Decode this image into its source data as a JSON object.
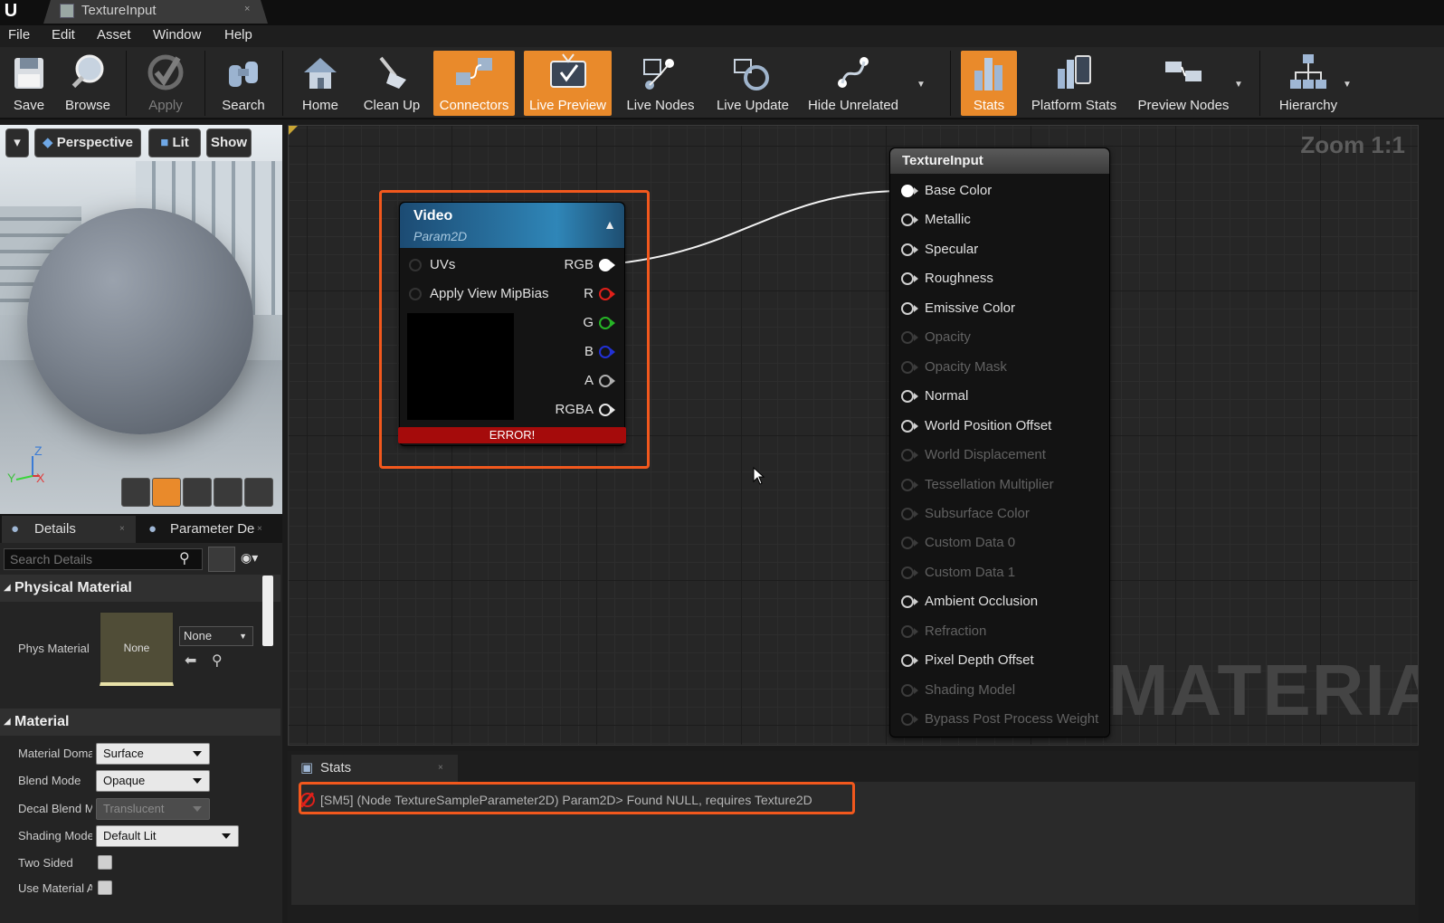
{
  "window": {
    "tab_title": "TextureInput",
    "tab_close": "×"
  },
  "menu": [
    "File",
    "Edit",
    "Asset",
    "Window",
    "Help"
  ],
  "toolbar": {
    "save": "Save",
    "browse": "Browse",
    "apply": "Apply",
    "search": "Search",
    "home": "Home",
    "clean_up": "Clean Up",
    "connectors": "Connectors",
    "live_preview": "Live Preview",
    "live_nodes": "Live Nodes",
    "live_update": "Live Update",
    "hide_unrelated": "Hide Unrelated",
    "stats": "Stats",
    "platform_stats": "Platform Stats",
    "preview_nodes": "Preview Nodes",
    "hierarchy": "Hierarchy"
  },
  "viewport": {
    "perspective": "Perspective",
    "lit": "Lit",
    "show": "Show",
    "axis_z": "Z",
    "axis_x": "X",
    "axis_y": "Y"
  },
  "details": {
    "tab_details": "Details",
    "tab_parameter": "Parameter De",
    "search_placeholder": "Search Details",
    "section_physical": "Physical Material",
    "phys_material_label": "Phys Material",
    "phys_thumb": "None",
    "phys_combo": "None",
    "section_material": "Material",
    "props": [
      {
        "label": "Material Doma",
        "value": "Surface"
      },
      {
        "label": "Blend Mode",
        "value": "Opaque"
      },
      {
        "label": "Decal Blend M",
        "value": "Translucent"
      },
      {
        "label": "Shading Mode",
        "value": "Default Lit"
      },
      {
        "label": "Two Sided",
        "value": ""
      },
      {
        "label": "Use Material A",
        "value": ""
      }
    ]
  },
  "graph": {
    "zoom": "Zoom 1:1",
    "watermark": "MATERIAL"
  },
  "video_node": {
    "title": "Video",
    "subtitle": "Param2D",
    "inputs": [
      "UVs",
      "Apply View MipBias"
    ],
    "outputs": [
      "RGB",
      "R",
      "G",
      "B",
      "A",
      "RGBA"
    ],
    "error": "ERROR!"
  },
  "texture_node": {
    "title": "TextureInput",
    "pins": [
      {
        "label": "Base Color",
        "enabled": true
      },
      {
        "label": "Metallic",
        "enabled": true
      },
      {
        "label": "Specular",
        "enabled": true
      },
      {
        "label": "Roughness",
        "enabled": true
      },
      {
        "label": "Emissive Color",
        "enabled": true
      },
      {
        "label": "Opacity",
        "enabled": false
      },
      {
        "label": "Opacity Mask",
        "enabled": false
      },
      {
        "label": "Normal",
        "enabled": true
      },
      {
        "label": "World Position Offset",
        "enabled": true
      },
      {
        "label": "World Displacement",
        "enabled": false
      },
      {
        "label": "Tessellation Multiplier",
        "enabled": false
      },
      {
        "label": "Subsurface Color",
        "enabled": false
      },
      {
        "label": "Custom Data 0",
        "enabled": false
      },
      {
        "label": "Custom Data 1",
        "enabled": false
      },
      {
        "label": "Ambient Occlusion",
        "enabled": true
      },
      {
        "label": "Refraction",
        "enabled": false
      },
      {
        "label": "Pixel Depth Offset",
        "enabled": true
      },
      {
        "label": "Shading Model",
        "enabled": false
      },
      {
        "label": "Bypass Post Process Weight",
        "enabled": false
      }
    ]
  },
  "stats": {
    "tab": "Stats",
    "message": "[SM5] (Node TextureSampleParameter2D) Param2D> Found NULL, requires Texture2D"
  },
  "colors": {
    "accent": "#e98a2b",
    "highlight": "#f2581d",
    "error": "#a50b0b",
    "pin_r": "#e0201a",
    "pin_g": "#26b526",
    "pin_b": "#2231d6"
  }
}
